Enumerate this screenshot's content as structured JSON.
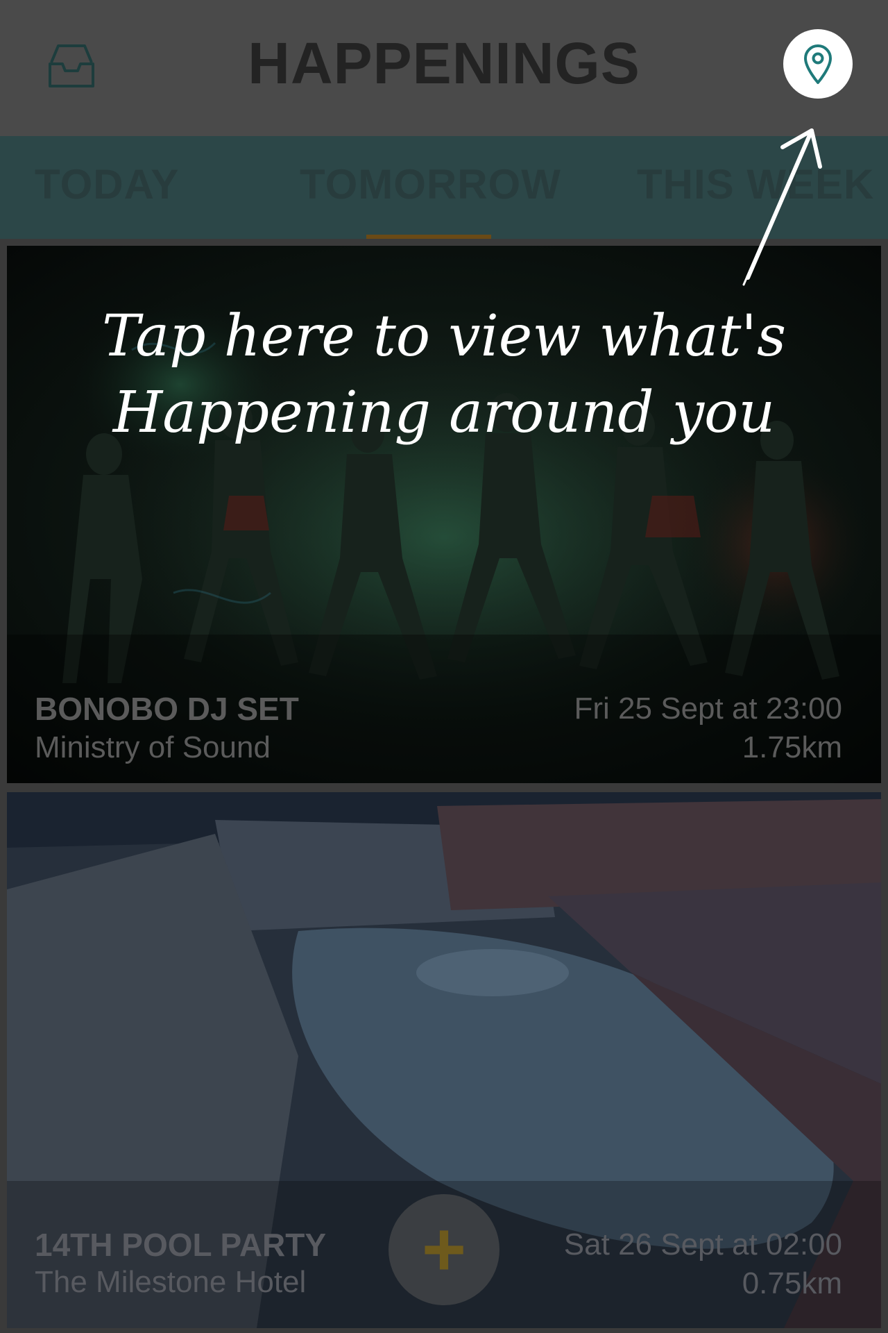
{
  "header": {
    "title": "HAPPENINGS",
    "inbox_icon": "inbox-tray-icon",
    "location_icon": "map-pin-icon"
  },
  "tabs": [
    {
      "label": "TODAY"
    },
    {
      "label": "TOMORROW",
      "selected": true
    },
    {
      "label": "THIS WEEK"
    }
  ],
  "events": [
    {
      "title": "BONOBO DJ SET",
      "venue": "Ministry of Sound",
      "when": "Fri 25 Sept at 23:00",
      "distance": "1.75km"
    },
    {
      "title": "14TH POOL PARTY",
      "venue": "The Milestone Hotel",
      "when": "Sat 26 Sept at 02:00",
      "distance": "0.75km"
    }
  ],
  "fab": {
    "label": "+",
    "icon": "plus-icon"
  },
  "hint": {
    "text": "Tap here to view what's Happening around you",
    "arrow_icon": "hand-drawn-arrow-icon"
  },
  "colors": {
    "accent_teal": "#1f5f5f",
    "accent_gold": "#6a4a16",
    "overlay": "#000000"
  }
}
